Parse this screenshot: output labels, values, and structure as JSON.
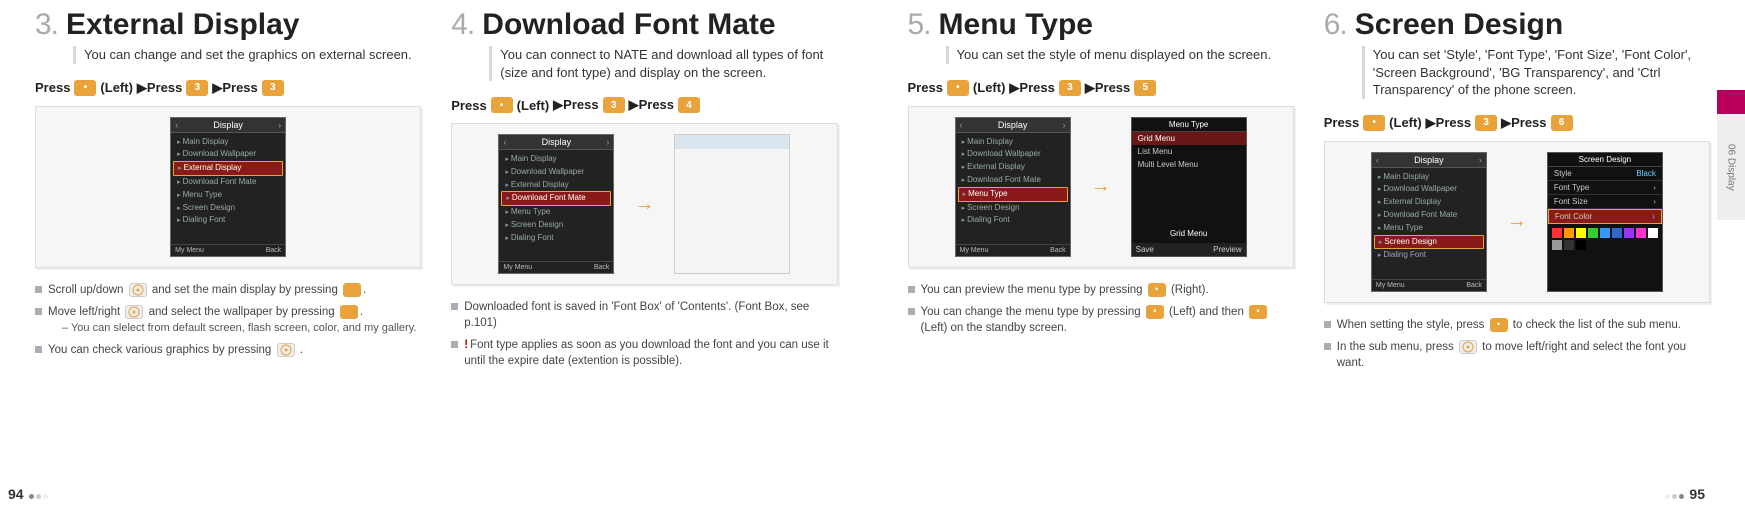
{
  "page_left_num": "94",
  "page_right_num": "95",
  "side_tab": "06  Display",
  "sections": [
    {
      "num": "3.",
      "title": "External Display",
      "desc": "You can change and set the graphics on external screen.",
      "press": {
        "pre": "Press",
        "left": "(Left)",
        "mid": "▶Press",
        "key2": "3",
        "mid2": "▶Press",
        "key3": "3"
      },
      "screen": {
        "header": "Display",
        "items": [
          "Main Display",
          "Download Wallpaper",
          "External Display",
          "Download Font Mate",
          "Menu Type",
          "Screen Design",
          "Dialing Font"
        ],
        "selected": 2,
        "foot_l": "My Menu",
        "foot_r": "Back"
      },
      "bullets": [
        {
          "t1": "Scroll up/down ",
          "t2": " and set the main display by pressing ",
          "t3": "."
        },
        {
          "t1": "Move left/right ",
          "t2": " and select the wallpaper by pressing ",
          "t3": ".",
          "sub": "–  You can slelect from default screen, flash screen, color, and my gallery."
        },
        {
          "t1": "You can check various graphics by pressing ",
          "t2": " ."
        }
      ]
    },
    {
      "num": "4.",
      "title": "Download Font Mate",
      "desc": "You can connect to NATE and download all types of font (size and font type) and display on the screen.",
      "press": {
        "pre": "Press",
        "left": "(Left)",
        "mid": "▶Press",
        "key2": "3",
        "mid2": "▶Press",
        "key3": "4"
      },
      "screen": {
        "header": "Display",
        "items": [
          "Main Display",
          "Download Wallpaper",
          "External Display",
          "Download Font Mate",
          "Menu Type",
          "Screen Design",
          "Dialing Font"
        ],
        "selected": 3,
        "foot_l": "My Menu",
        "foot_r": "Back"
      },
      "bullets": [
        {
          "plain": "Downloaded font is saved in 'Font Box' of 'Contents'. (Font Box, see p.101)"
        },
        {
          "bang": true,
          "plain": "Font type applies as soon as you download the font and you can use it until the expire date (extention is possible)."
        }
      ]
    },
    {
      "num": "5.",
      "title": "Menu Type",
      "desc": "You can set the style of menu displayed on the screen.",
      "press": {
        "pre": "Press",
        "left": "(Left)",
        "mid": "▶Press",
        "key2": "3",
        "mid2": "▶Press",
        "key3": "5"
      },
      "screen": {
        "header": "Display",
        "items": [
          "Main Display",
          "Download Wallpaper",
          "External Display",
          "Download Font Mate",
          "Menu Type",
          "Screen Design",
          "Dialing Font"
        ],
        "selected": 4,
        "foot_l": "My Menu",
        "foot_r": "Back"
      },
      "screen2": {
        "header": "Menu Type",
        "opts": [
          "Grid Menu",
          "List Menu",
          "Multi Level Menu"
        ],
        "selected": 0,
        "sub_label": "Grid Menu",
        "foot_l": "Save",
        "foot_r": "Preview"
      },
      "bullets": [
        {
          "t1": "You can preview the menu type by pressing ",
          "t2": " (Right)."
        },
        {
          "t1": "You can change the menu type by pressing ",
          "t2": " (Left) and then ",
          "t3": " (Left) on the standby screen."
        }
      ]
    },
    {
      "num": "6.",
      "title": "Screen Design",
      "desc": "You can set 'Style', 'Font Type', 'Font Size', 'Font Color', 'Screen Background', 'BG Transparency', and 'Ctrl Transparency' of the phone screen.",
      "press": {
        "pre": "Press",
        "left": "(Left)",
        "mid": "▶Press",
        "key2": "3",
        "mid2": "▶Press",
        "key3": "6"
      },
      "screen": {
        "header": "Display",
        "items": [
          "Main Display",
          "Download Wallpaper",
          "External Display",
          "Download Font Mate",
          "Menu Type",
          "Screen Design",
          "Dialing Font"
        ],
        "selected": 5,
        "foot_l": "My Menu",
        "foot_r": "Back"
      },
      "screen2": {
        "header": "Screen Design",
        "rows": [
          {
            "k": "Style",
            "v": "Black"
          },
          {
            "k": "Font Type",
            "v": ""
          },
          {
            "k": "Font Size",
            "v": ""
          },
          {
            "k": "Font Color",
            "v": "",
            "sel": true
          }
        ]
      },
      "bullets": [
        {
          "t1": "When setting the style, press ",
          "t2": " to check the list of the sub menu."
        },
        {
          "t1": "In the sub menu, press ",
          "t2": " to move left/right and select the font you want."
        }
      ]
    }
  ]
}
